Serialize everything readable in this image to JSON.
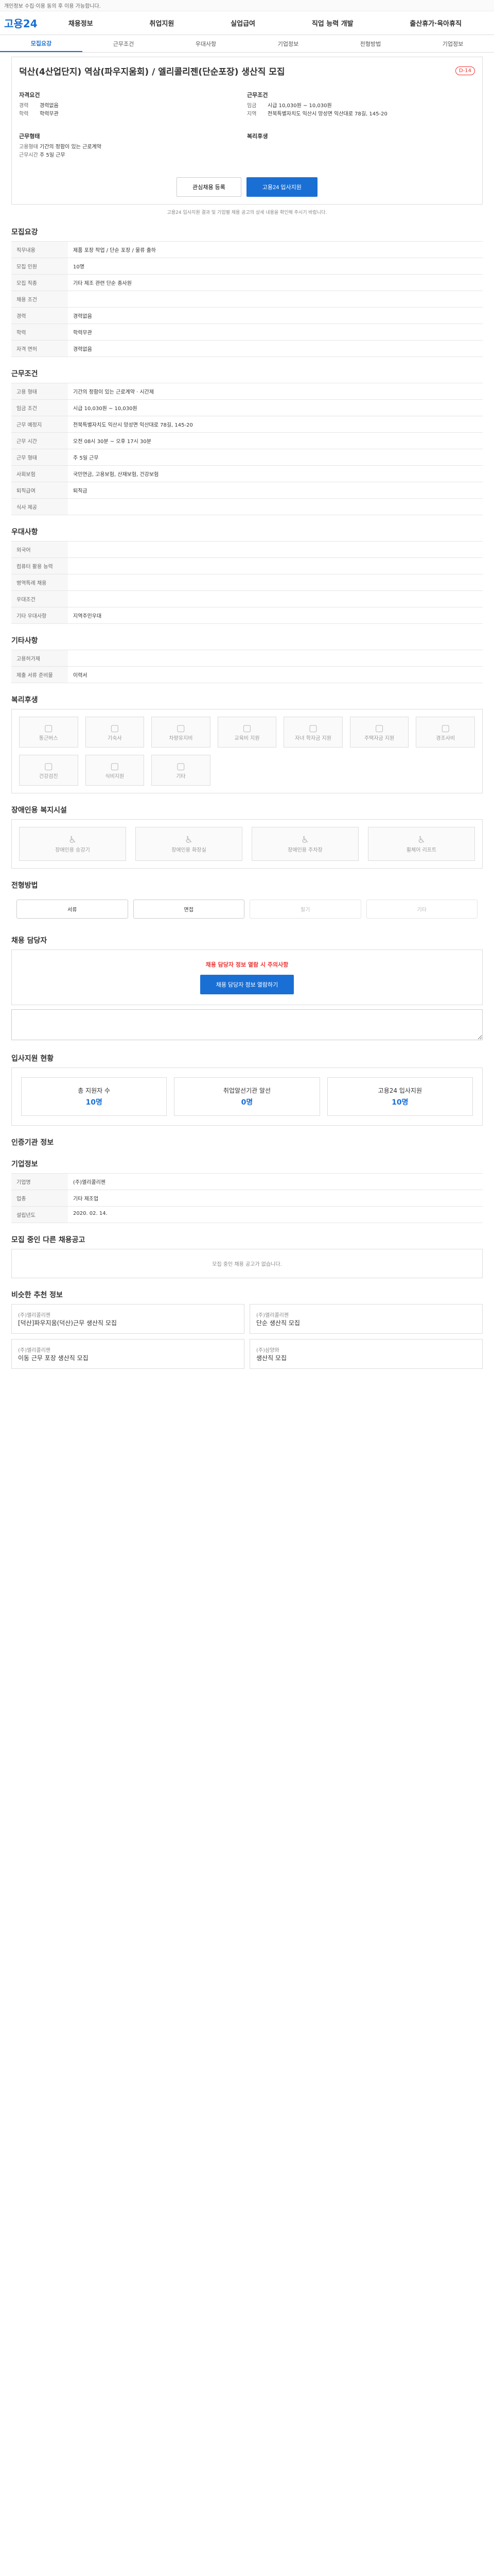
{
  "topnotice": "개인정보 수집·이용 동의 후 이용 가능합니다.",
  "logo": "고용24",
  "gnb": [
    "채용정보",
    "취업지원",
    "실업급여",
    "직업 능력 개발",
    "출산휴가·육아휴직"
  ],
  "tabs": [
    "모집요강",
    "근무조건",
    "우대사항",
    "기업정보",
    "전형방법",
    "기업정보"
  ],
  "job": {
    "title": "덕산(4산업단지) 역삼(파우지움회) / 엘리콜리젠(단순포장) 생산직 모집",
    "dday": "D-14"
  },
  "summary": {
    "left": {
      "label": "자격요건",
      "rows": [
        [
          "경력",
          "경력없음"
        ],
        [
          "학력",
          "학력무관"
        ]
      ]
    },
    "right": {
      "label": "근무조건",
      "rows": [
        [
          "임금",
          "시급 10,030원 ~ 10,030원"
        ],
        [
          "지역",
          "전북특별자치도 익산시 망성면 익산대로 78길, 145-20"
        ]
      ]
    }
  },
  "summary2": {
    "left": {
      "label": "근무형태",
      "rows": [
        [
          "고용형태",
          "기간의 정함이 있는 근로계약"
        ],
        [
          "근무시간",
          "주 5일 근무"
        ]
      ]
    },
    "right": {
      "label": "복리후생",
      "rows": []
    }
  },
  "buttons": {
    "save": "관심채용 등록",
    "apply": "고용24 입사지원"
  },
  "note": "고용24 입사지원 결과 및 기업별 채용 공고의 상세 내용을 확인해 주시기 바랍니다.",
  "sections": {
    "s1": {
      "title": "모집요강",
      "rows": [
        [
          "직무내용",
          "제품 포장 작업 / 단순 포장 / 물류 출하"
        ],
        [
          "모집 인원",
          "10명"
        ],
        [
          "모집 직종",
          "기타 제조 관련 단순 종사원"
        ],
        [
          "채용 조건",
          ""
        ],
        [
          "경력",
          "경력없음"
        ],
        [
          "학력",
          "학력무관"
        ],
        [
          "자격 면허",
          "경력없음"
        ]
      ]
    },
    "s2": {
      "title": "근무조건",
      "rows": [
        [
          "고용 형태",
          "기간의 정함이 있는 근로계약 · 시간제"
        ],
        [
          "임금 조건",
          "시급 10,030원 ~ 10,030원"
        ],
        [
          "근무 예정지",
          "전북특별자치도 익산시 망성면 익산대로 78길, 145-20"
        ],
        [
          "근무 시간",
          "오전 08시 30분 ~ 오후 17시 30분"
        ],
        [
          "근무 형태",
          "주 5일 근무"
        ],
        [
          "사회보험",
          "국민연금, 고용보험, 산재보험, 건강보험"
        ],
        [
          "퇴직급여",
          "퇴직금"
        ],
        [
          "식사 제공",
          ""
        ]
      ]
    },
    "s3": {
      "title": "우대사항",
      "rows": [
        [
          "외국어",
          ""
        ],
        [
          "컴퓨터 활용 능력",
          ""
        ],
        [
          "병역특례 채용",
          ""
        ],
        [
          "우대조건",
          ""
        ],
        [
          "기타 우대사항",
          "지역주민우대"
        ]
      ]
    },
    "s4": {
      "title": "기타사항",
      "rows": [
        [
          "고용허가제",
          ""
        ],
        [
          "제출 서류 준비물",
          "이력서"
        ]
      ]
    },
    "s5": {
      "title": "복리후생",
      "items": [
        "통근버스",
        "기숙사",
        "차량유지비",
        "교육비 지원",
        "자녀 학자금 지원",
        "주택자금 지원",
        "경조사비",
        "건강검진",
        "식비지원",
        "기타"
      ]
    },
    "s6": {
      "title": "장애인용 복지시설",
      "items": [
        "장애인용 승강기",
        "장애인용 화장실",
        "장애인용 주차장",
        "휠체어 리프트"
      ]
    },
    "s7": {
      "title": "전형방법",
      "methods": [
        "서류",
        "면접",
        "필기",
        "기타"
      ]
    },
    "s8": {
      "title": "채용 담당자",
      "warn": "채용 담당자 정보 열람 시 주의사항",
      "btn": "채용 담당자 정보 열람하기"
    },
    "s9": {
      "title": "입사지원 현황",
      "stats": [
        [
          "총 지원자 수",
          "10명"
        ],
        [
          "취업알선기관 알선",
          "0명"
        ],
        [
          "고용24 입사지원",
          "10명"
        ]
      ]
    },
    "s10": {
      "title": "인증기관 정보"
    },
    "s11": {
      "title": "기업정보",
      "rows": [
        [
          "기업명",
          "(주)엘리콜리젠"
        ],
        [
          "업종",
          "기타 제조업"
        ],
        [
          "설립년도",
          "2020. 02. 14."
        ]
      ]
    },
    "s12": {
      "title": "모집 중인 다른 채용공고",
      "empty": "모집 중인 채용 공고가 없습니다."
    },
    "s13": {
      "title": "비슷한 추천 정보",
      "cards": [
        [
          "(주)엘리콜리젠",
          "[덕산]파우지움(덕산)근무 생산직 모집"
        ],
        [
          "(주)엘리콜리젠",
          "단순 생산직 모집"
        ],
        [
          "(주)엘리콜리젠",
          "이동 근무 포장 생산직 모집"
        ],
        [
          "(주)삼양와",
          "생산직 모집"
        ]
      ]
    }
  }
}
